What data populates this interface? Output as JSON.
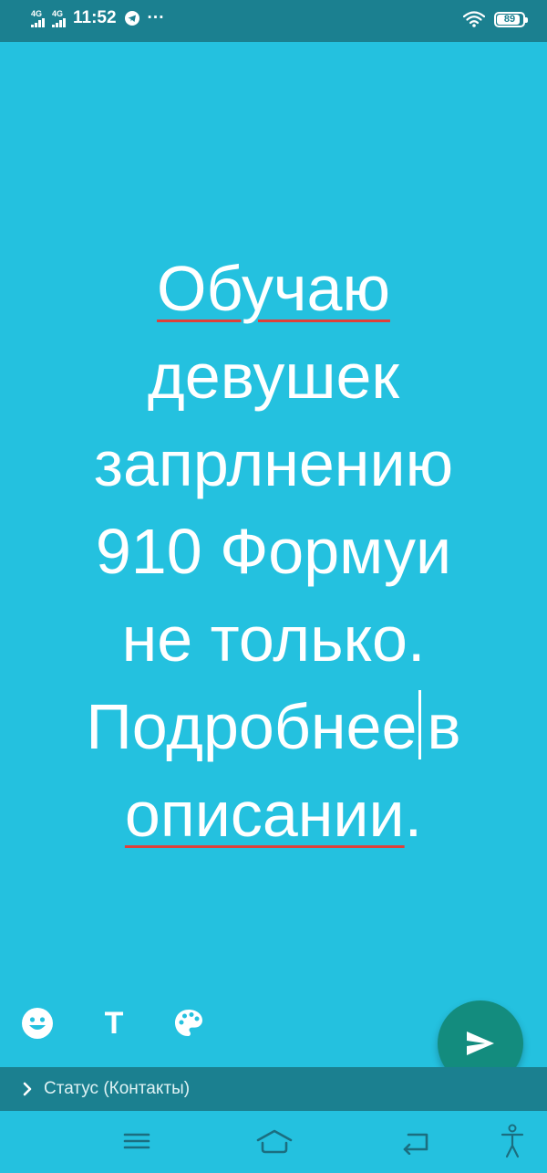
{
  "status_bar": {
    "network_1": "4G",
    "network_2": "4G",
    "time": "11:52",
    "more": "···",
    "battery_level": 89,
    "battery_text": "89"
  },
  "editor": {
    "lines": [
      {
        "text": "Обучаю",
        "spellcheck": true
      },
      {
        "text": "девушек",
        "spellcheck": false
      },
      {
        "text": "запрлнению",
        "spellcheck": false
      },
      {
        "text": "910 Формуи",
        "spellcheck": false
      },
      {
        "text": "не только.",
        "spellcheck": false
      }
    ],
    "line6_before_caret": "Подробнее",
    "line6_after_caret": "в",
    "line7_word": "описании",
    "line7_punct": ".",
    "text_color": "#FFFFFF",
    "background_color": "#24C1DF",
    "spellcheck_color": "#E0403A"
  },
  "toolbar": {
    "emoji_icon": "smiley-icon",
    "text_button_label": "T",
    "palette_icon": "palette-icon"
  },
  "send_button": {
    "icon": "send-icon",
    "color": "#138C7E"
  },
  "caption": {
    "text": "Статус (Контакты)"
  },
  "nav": {
    "menu": "menu-icon",
    "home": "home-icon",
    "back": "back-icon",
    "accessibility": "accessibility-icon"
  }
}
